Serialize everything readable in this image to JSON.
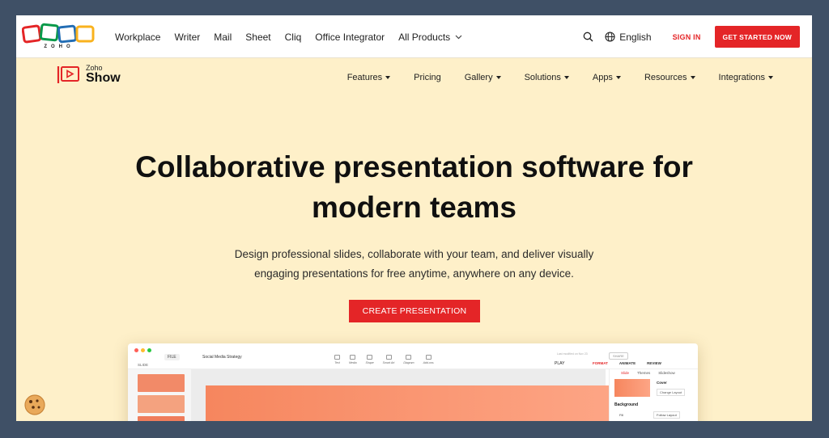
{
  "topbar": {
    "brand": "ZOHO",
    "nav": [
      "Workplace",
      "Writer",
      "Mail",
      "Sheet",
      "Cliq",
      "Office Integrator",
      "All Products"
    ],
    "language": "English",
    "sign_in": "SIGN IN",
    "get_started": "GET STARTED NOW"
  },
  "product_bar": {
    "logo_small": "Zoho",
    "logo_large": "Show",
    "nav": [
      {
        "label": "Features",
        "dropdown": true
      },
      {
        "label": "Pricing",
        "dropdown": false
      },
      {
        "label": "Gallery",
        "dropdown": true
      },
      {
        "label": "Solutions",
        "dropdown": true
      },
      {
        "label": "Apps",
        "dropdown": true
      },
      {
        "label": "Resources",
        "dropdown": true
      },
      {
        "label": "Integrations",
        "dropdown": true
      }
    ]
  },
  "hero": {
    "title_line1": "Collaborative presentation software for",
    "title_line2": "modern teams",
    "subtitle_line1": "Design professional slides, collaborate with your team, and deliver visually",
    "subtitle_line2": "engaging presentations for free anytime, anywhere on any device.",
    "cta": "CREATE PRESENTATION"
  },
  "preview": {
    "file_menu": "FILE",
    "doc_title": "Social Media Strategy",
    "slide_label": "SLIDE",
    "last_modified": "Last modified on Nov 23",
    "share": "SHARE",
    "tools": [
      "Text",
      "Media",
      "Shape",
      "Smart Art",
      "Diagram",
      "Add-ons"
    ],
    "play": "PLAY",
    "tabs": [
      "FORMAT",
      "ANIMATE",
      "REVIEW"
    ],
    "panel_tabs": [
      "Slide",
      "Themes",
      "Slideshow"
    ],
    "cover_label": "Cover",
    "change_layout": "Change Layout",
    "background_label": "Background",
    "fill_label": "Fill",
    "follow_layout": "Follow Layout"
  },
  "colors": {
    "brand_red": "#e42527",
    "hero_bg": "#fef0c9",
    "outer_bg": "#3f5066"
  }
}
